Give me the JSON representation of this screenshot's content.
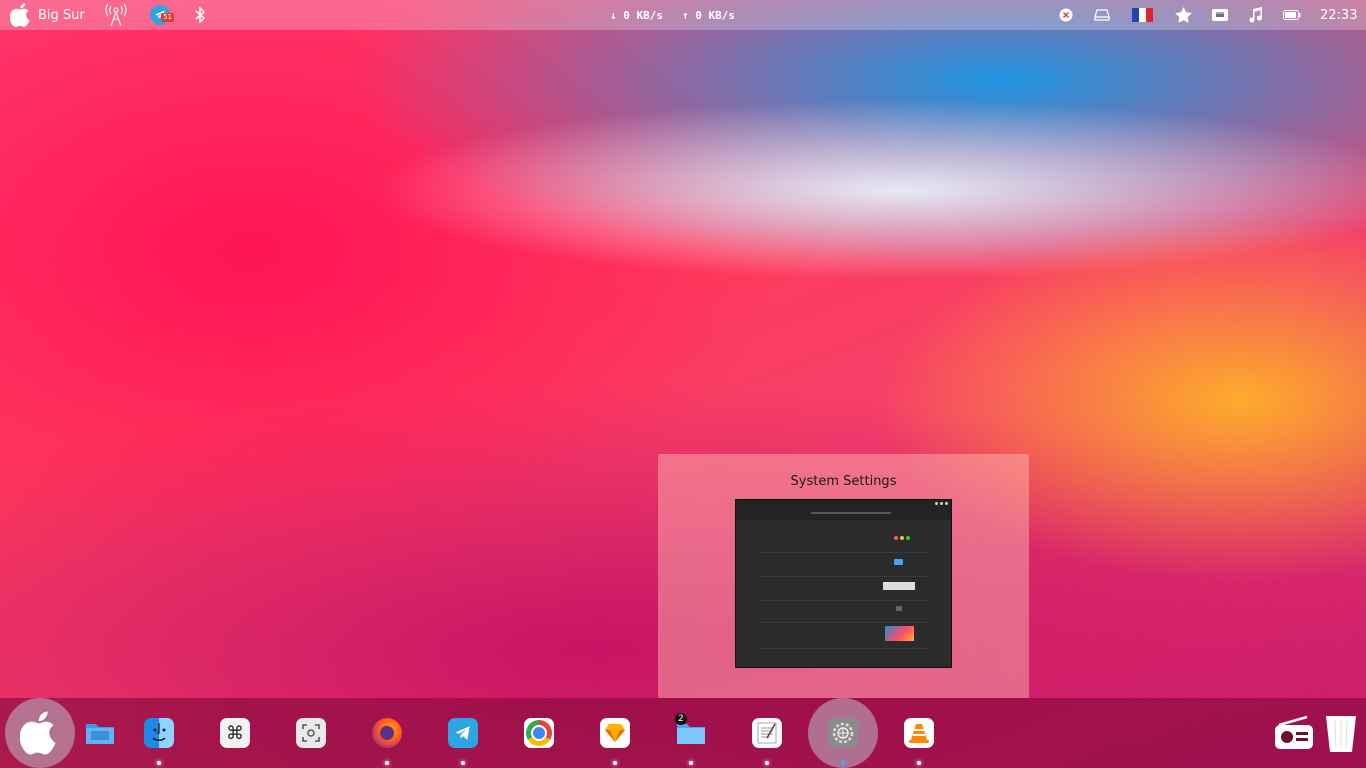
{
  "topbar": {
    "os_label": "Big Sur",
    "telegram_badge": "51",
    "download_speed": "↓ 0 KB/s",
    "upload_speed": "↑ 0 KB/s",
    "clock": "22:33"
  },
  "preview": {
    "title": "System Settings"
  },
  "dock": {
    "items": [
      {
        "name": "launcher",
        "icon": "apple-logo"
      },
      {
        "name": "files",
        "icon": "folder"
      },
      {
        "name": "finder",
        "icon": "finder-face"
      },
      {
        "name": "command",
        "icon": "command-key"
      },
      {
        "name": "screenshot",
        "icon": "screenshot"
      },
      {
        "name": "firefox",
        "icon": "firefox"
      },
      {
        "name": "telegram",
        "icon": "paper-plane"
      },
      {
        "name": "chrome",
        "icon": "chrome"
      },
      {
        "name": "sketch",
        "icon": "diamond"
      },
      {
        "name": "folder-stack",
        "icon": "folder",
        "count": "2"
      },
      {
        "name": "text-editor",
        "icon": "notepad"
      },
      {
        "name": "system-settings",
        "icon": "gear"
      },
      {
        "name": "vlc",
        "icon": "traffic-cone"
      }
    ],
    "radio_icon": "radio",
    "trash_icon": "trash"
  }
}
